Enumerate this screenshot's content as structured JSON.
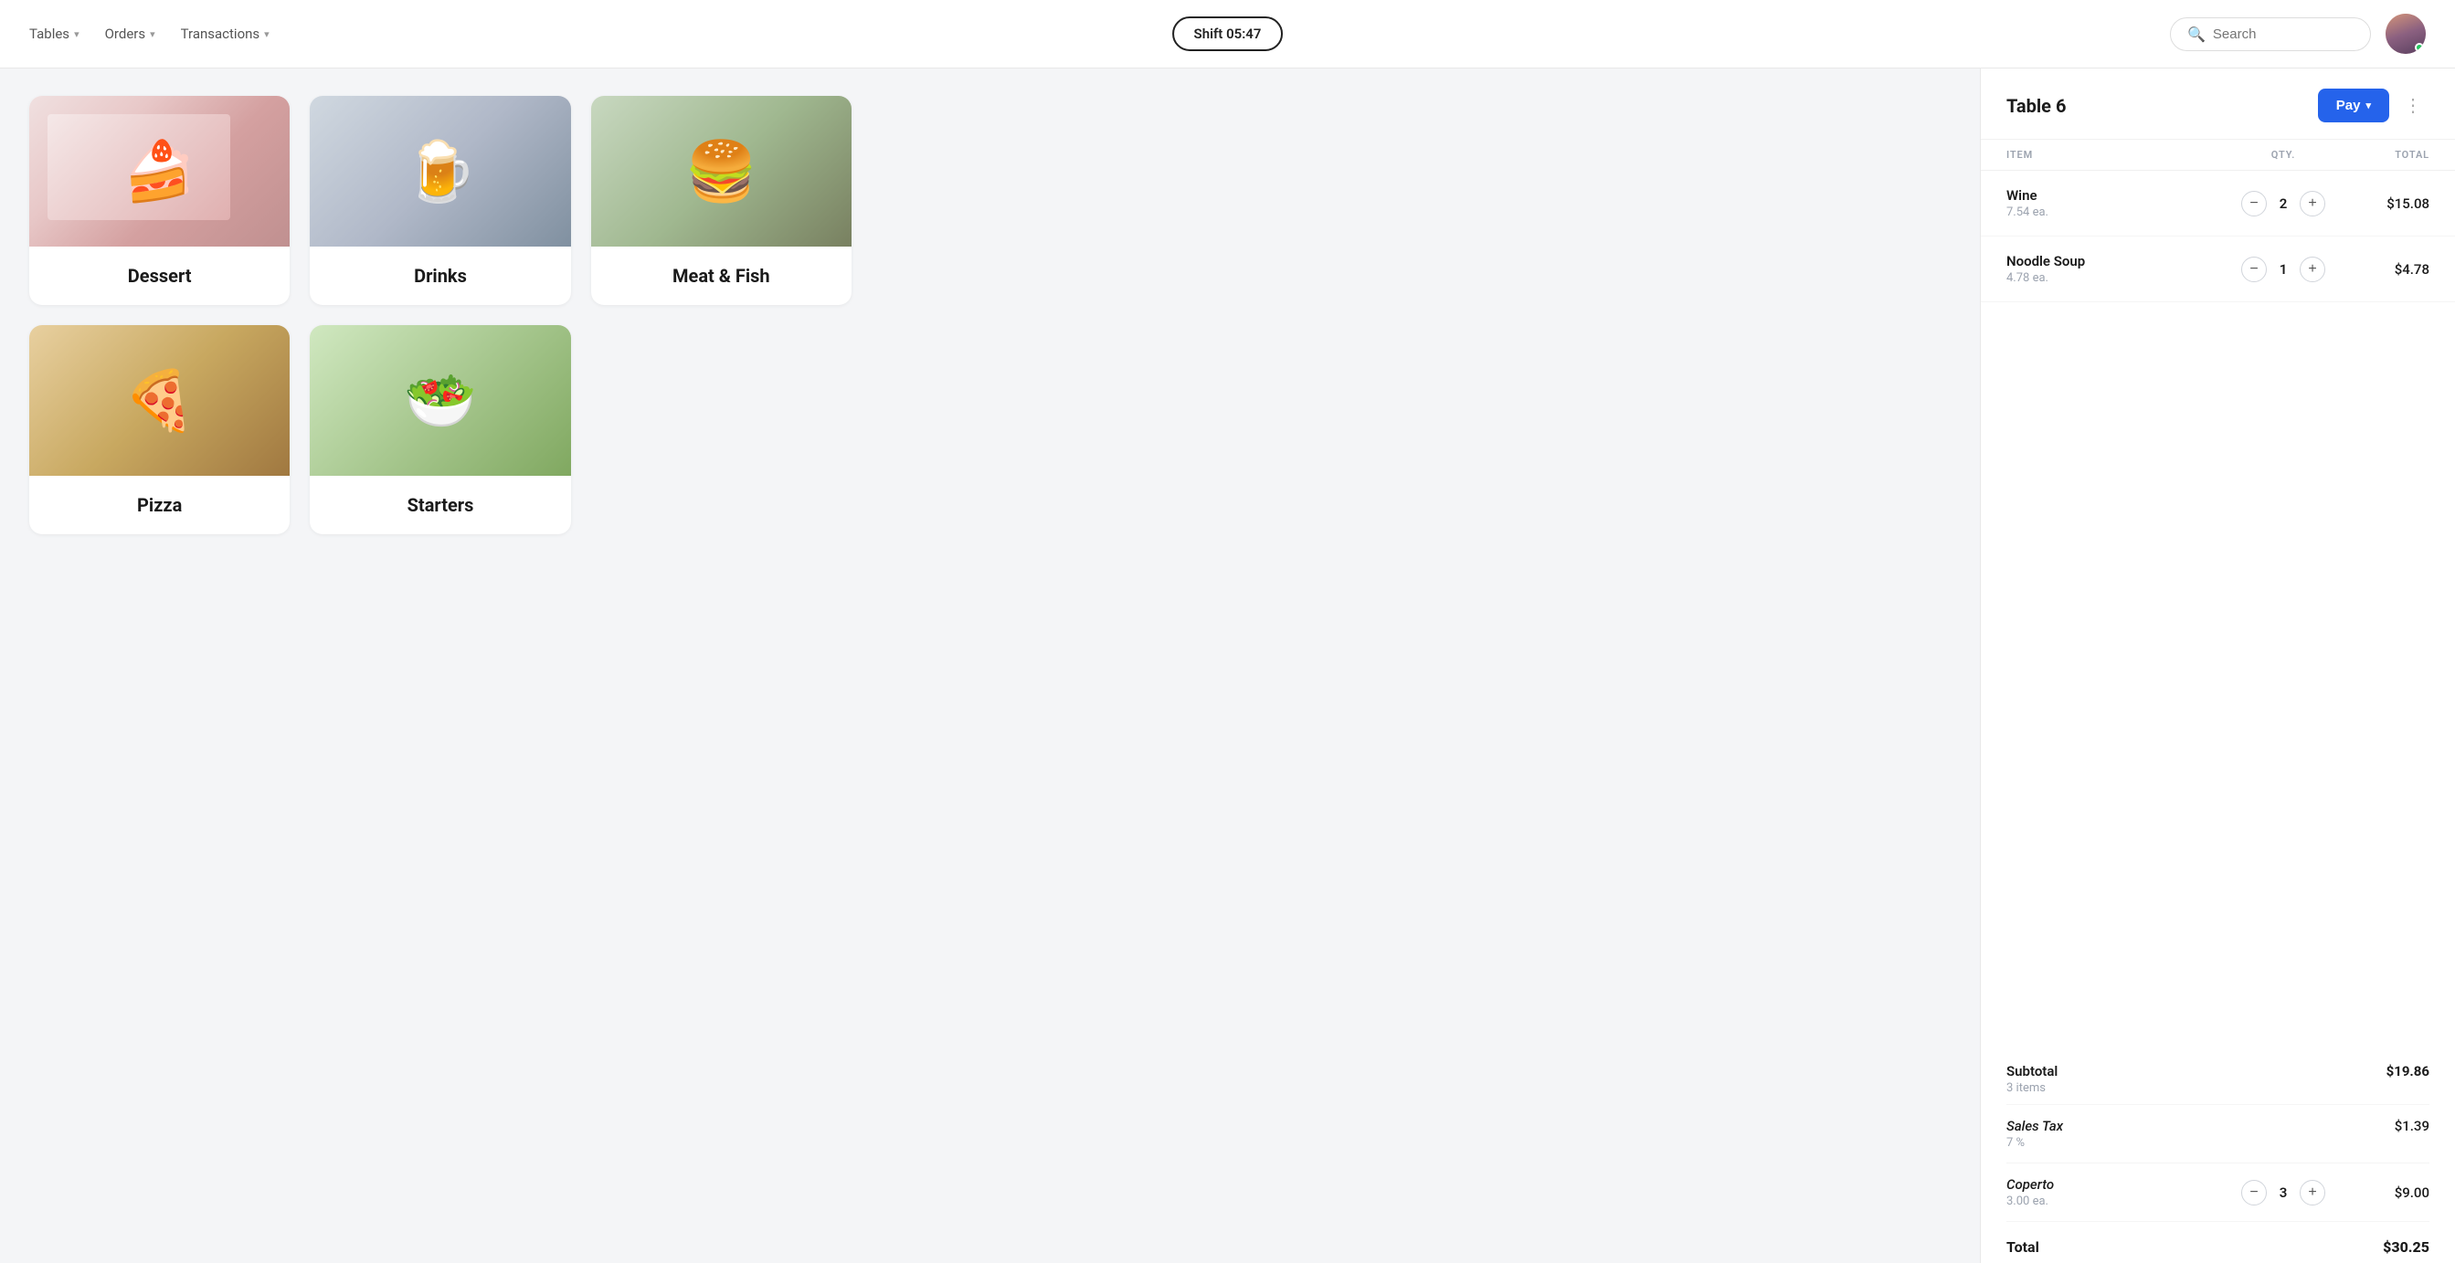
{
  "header": {
    "nav": [
      {
        "label": "Tables",
        "id": "tables"
      },
      {
        "label": "Orders",
        "id": "orders"
      },
      {
        "label": "Transactions",
        "id": "transactions"
      }
    ],
    "shift_label": "Shift 05:47",
    "search_placeholder": "Search"
  },
  "categories": [
    {
      "id": "dessert",
      "label": "Dessert",
      "img_class": "img-dessert"
    },
    {
      "id": "drinks",
      "label": "Drinks",
      "img_class": "img-drinks"
    },
    {
      "id": "meat-fish",
      "label": "Meat & Fish",
      "img_class": "img-meatfish"
    },
    {
      "id": "pizza",
      "label": "Pizza",
      "img_class": "img-pizza"
    },
    {
      "id": "starters",
      "label": "Starters",
      "img_class": "img-starters"
    }
  ],
  "order_panel": {
    "table_name": "Table 6",
    "pay_label": "Pay",
    "columns": {
      "item": "ITEM",
      "qty": "QTY.",
      "total": "TOTAL"
    },
    "items": [
      {
        "name": "Wine",
        "price_each": "7.54 ea.",
        "qty": 2,
        "total": "$15.08"
      },
      {
        "name": "Noodle Soup",
        "price_each": "4.78 ea.",
        "qty": 1,
        "total": "$4.78"
      }
    ],
    "subtotal": {
      "label": "Subtotal",
      "items_count": "3 items",
      "amount": "$19.86"
    },
    "sales_tax": {
      "label": "Sales Tax",
      "rate": "7 %",
      "amount": "$1.39"
    },
    "coperto": {
      "label": "Coperto",
      "price_each": "3.00 ea.",
      "qty": 3,
      "total": "$9.00"
    },
    "total": {
      "label": "Total",
      "amount": "$30.25"
    }
  },
  "icons": {
    "search": "🔍",
    "chevron_down": "▾",
    "minus": "−",
    "plus": "+",
    "more": "⋮"
  }
}
